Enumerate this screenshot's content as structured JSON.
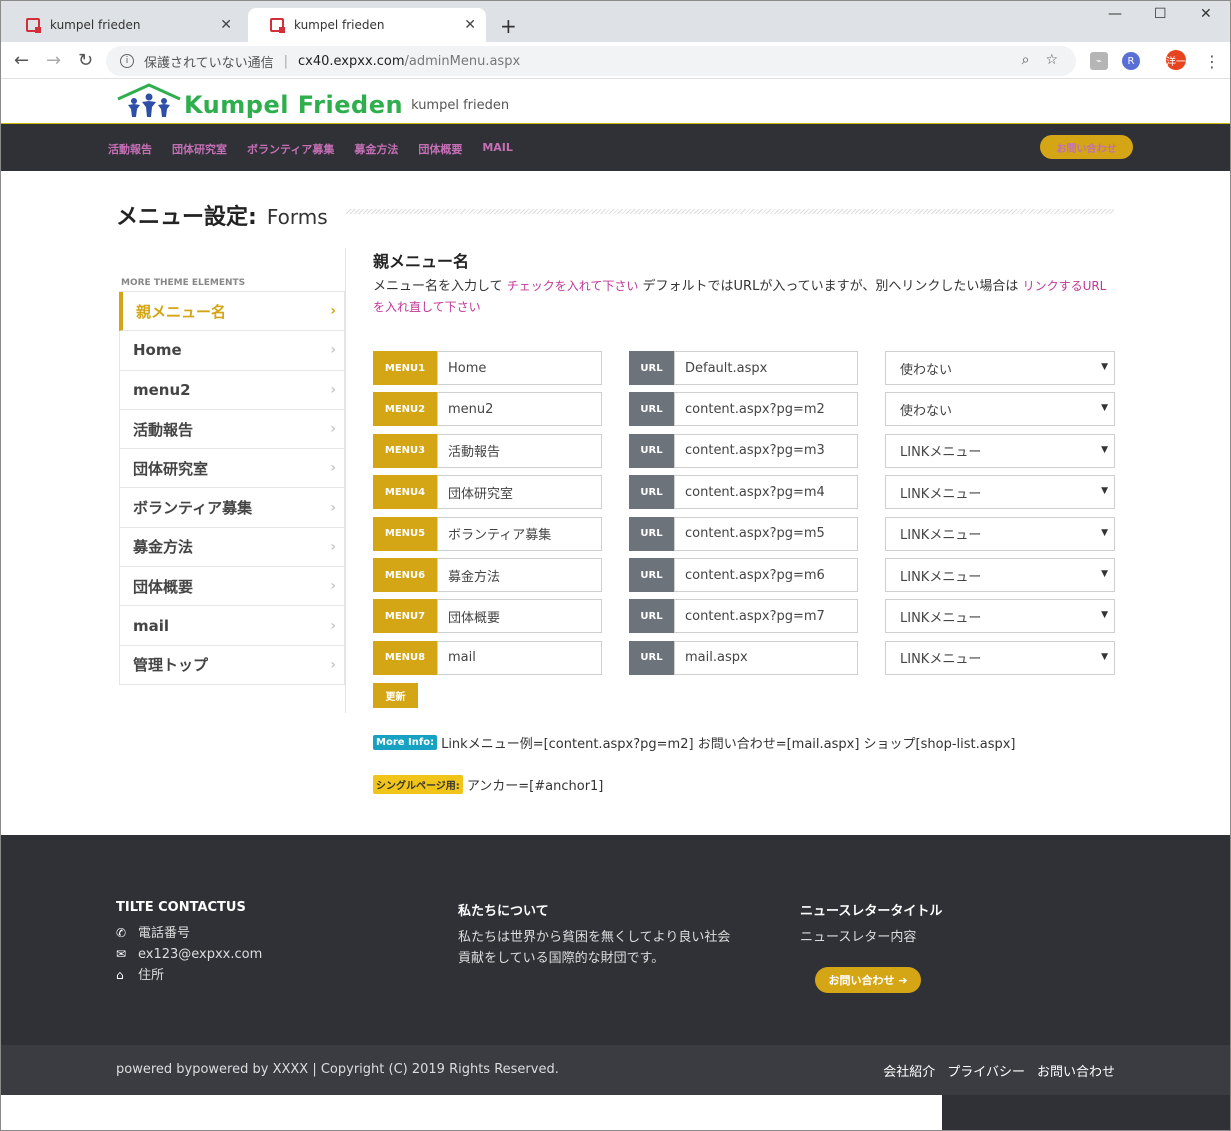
{
  "browser": {
    "tabs": [
      {
        "label": "kumpel frieden"
      },
      {
        "label": "kumpel frieden"
      }
    ],
    "new_tab": "+",
    "address": {
      "security": "保護されていない通信",
      "host": "cx40.expxx.com",
      "path": "/adminMenu.aspx"
    },
    "profile_initial": "洋一",
    "window_controls": {
      "minimize": "—",
      "maximize": "☐",
      "close": "✕"
    }
  },
  "site": {
    "logo_text": "Kumpel Frieden",
    "logo_sub": "kumpel frieden",
    "logo_color": "#2fae4e",
    "nav": [
      "活動報告",
      "団体研究室",
      "ボランティア募集",
      "募金方法",
      "団体概要",
      "MAIL"
    ],
    "contact_button": "お問い合わせ",
    "accent_color": "#d4a514",
    "nav_link_color": "#c46fb5"
  },
  "page": {
    "title_bold": "メニュー設定:",
    "title_normal": "Forms"
  },
  "sidebar": {
    "heading": "MORE THEME ELEMENTS",
    "items": [
      {
        "label": "親メニュー名",
        "active": true
      },
      {
        "label": "Home"
      },
      {
        "label": "menu2"
      },
      {
        "label": "活動報告"
      },
      {
        "label": "団体研究室"
      },
      {
        "label": "ボランティア募集"
      },
      {
        "label": "募金方法"
      },
      {
        "label": "団体概要"
      },
      {
        "label": "mail"
      },
      {
        "label": "管理トップ"
      }
    ]
  },
  "section": {
    "title": "親メニュー名",
    "desc_part1": "メニュー名を入力して ",
    "desc_hl1": "チェックを入れて下さい",
    "desc_part2": " デフォルトではURLが入っていますが、別へリンクしたい場合は ",
    "desc_hl2": "リンクするURLを入れ直して下さい"
  },
  "menu_rows": [
    {
      "label": "MENU1",
      "name": "Home",
      "url_label": "URL",
      "url": "Default.aspx",
      "option": "使わない"
    },
    {
      "label": "MENU2",
      "name": "menu2",
      "url_label": "URL",
      "url": "content.aspx?pg=m2",
      "option": "使わない"
    },
    {
      "label": "MENU3",
      "name": "活動報告",
      "url_label": "URL",
      "url": "content.aspx?pg=m3",
      "option": "LINKメニュー"
    },
    {
      "label": "MENU4",
      "name": "団体研究室",
      "url_label": "URL",
      "url": "content.aspx?pg=m4",
      "option": "LINKメニュー"
    },
    {
      "label": "MENU5",
      "name": "ボランティア募集",
      "url_label": "URL",
      "url": "content.aspx?pg=m5",
      "option": "LINKメニュー"
    },
    {
      "label": "MENU6",
      "name": "募金方法",
      "url_label": "URL",
      "url": "content.aspx?pg=m6",
      "option": "LINKメニュー"
    },
    {
      "label": "MENU7",
      "name": "団体概要",
      "url_label": "URL",
      "url": "content.aspx?pg=m7",
      "option": "LINKメニュー"
    },
    {
      "label": "MENU8",
      "name": "mail",
      "url_label": "URL",
      "url": "mail.aspx",
      "option": "LINKメニュー"
    }
  ],
  "update_button": "更新",
  "notes": [
    {
      "badge": "More Info:",
      "text": "Linkメニュー例=[content.aspx?pg=m2] お問い合わせ=[mail.aspx] ショップ[shop-list.aspx]"
    },
    {
      "badge": "シングルページ用:",
      "text": "アンカー=[#anchor1]"
    }
  ],
  "footer": {
    "contact": {
      "title": "TILTE CONTACTUS",
      "phone": "電話番号",
      "email": "ex123@expxx.com",
      "address": "住所"
    },
    "about": {
      "title": "私たちについて",
      "line1": "私たちは世界から貧困を無くしてより良い社会",
      "line2": "貢献をしている国際的な財団です。"
    },
    "newsletter": {
      "title": "ニュースレタータイトル",
      "body": "ニュースレター内容",
      "button": "お問い合わせ ➔"
    },
    "copyright": "powered bypowered by XXXX | Copyright (C) 2019 Rights Reserved.",
    "links": [
      "会社紹介",
      "プライバシー",
      "お問い合わせ"
    ]
  }
}
